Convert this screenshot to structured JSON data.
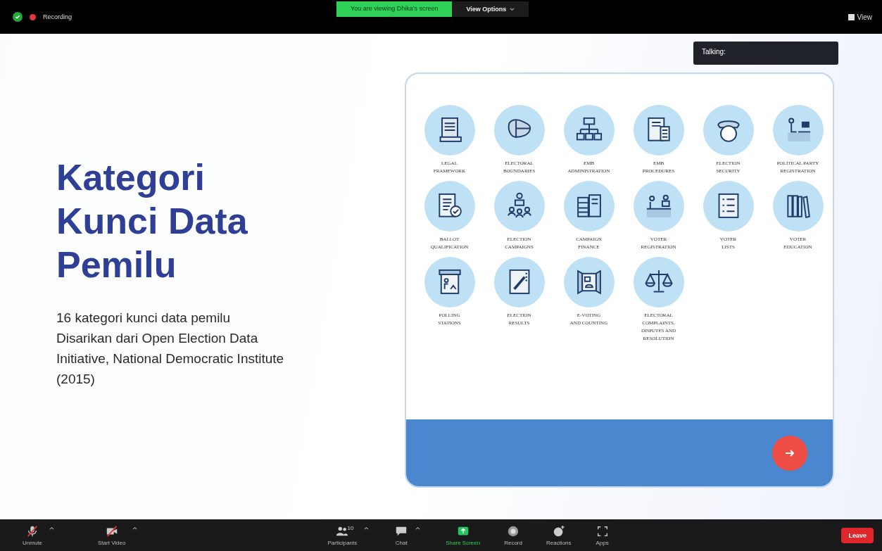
{
  "top_bar": {
    "recording": "Recording",
    "banner": "You are viewing Dhika's screen",
    "view_options": "View Options",
    "view": "View"
  },
  "talking": {
    "label": "Talking:"
  },
  "slide": {
    "title": "Kategori Kunci Data Pemilu",
    "subtitle": "16 kategori kunci data pemilu",
    "source": "Disarikan dari Open Election Data Initiative, National Democratic Institute (2015)",
    "categories": [
      {
        "label_lines": [
          "LEGAL",
          "FRAMEWORK"
        ]
      },
      {
        "label_lines": [
          "ELECTORAL",
          "BOUNDARIES"
        ]
      },
      {
        "label_lines": [
          "EMB",
          "ADMINISTRATION"
        ]
      },
      {
        "label_lines": [
          "EMB",
          "PROCEDURES"
        ]
      },
      {
        "label_lines": [
          "ELECTION",
          "SECURITY"
        ]
      },
      {
        "label_lines": [
          "POLITICAL PARTY",
          "REGISTRATION"
        ]
      },
      {
        "label_lines": [
          "BALLOT",
          "QUALIFICATION"
        ]
      },
      {
        "label_lines": [
          "ELECTION",
          "CAMPAIGNS"
        ]
      },
      {
        "label_lines": [
          "CAMPAIGN",
          "FINANCE"
        ]
      },
      {
        "label_lines": [
          "VOTER",
          "REGISTRATION"
        ]
      },
      {
        "label_lines": [
          "VOTER",
          "LISTS"
        ]
      },
      {
        "label_lines": [
          "VOTER",
          "EDUCATION"
        ]
      },
      {
        "label_lines": [
          "POLLING",
          "STATIONS"
        ]
      },
      {
        "label_lines": [
          "ELECTION",
          "RESULTS"
        ]
      },
      {
        "label_lines": [
          "E-VOTING",
          "AND COUNTING"
        ]
      },
      {
        "label_lines": [
          "ELECTORAL",
          "COMPLAINTS,",
          "DISPUTES AND",
          "RESOLUTION"
        ]
      }
    ]
  },
  "toolbar": {
    "items": [
      {
        "kind": "mic",
        "label": "Unmute",
        "menu": true
      },
      {
        "kind": "video",
        "label": "Start Video",
        "menu": true
      },
      {
        "kind": "participants",
        "label": "Participants",
        "count": "10",
        "menu": true
      },
      {
        "kind": "chat",
        "label": "Chat",
        "menu": true
      },
      {
        "kind": "share",
        "label": "Share Screen",
        "menu": false
      },
      {
        "kind": "record",
        "label": "Record",
        "menu": false
      },
      {
        "kind": "reactions",
        "label": "Reactions",
        "menu": false
      },
      {
        "kind": "apps",
        "label": "Apps",
        "menu": false
      }
    ],
    "leave": "Leave"
  }
}
